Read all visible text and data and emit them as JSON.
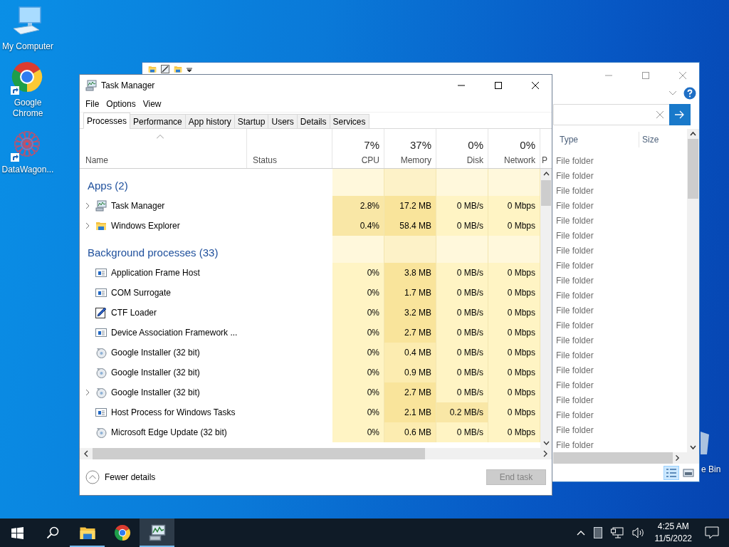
{
  "desktop": {
    "icons": [
      {
        "label": "My Computer",
        "kind": "computer",
        "shortcut": false
      },
      {
        "label": "Google Chrome",
        "kind": "chrome",
        "shortcut": true
      },
      {
        "label": "DataWagon...",
        "kind": "flake",
        "shortcut": true
      }
    ],
    "recycle_bin": {
      "label": "e Bin"
    }
  },
  "explorer": {
    "columns": [
      "Type",
      "Size"
    ],
    "rows": [
      {
        "type": "File folder"
      },
      {
        "type": "File folder"
      },
      {
        "type": "File folder"
      },
      {
        "type": "File folder"
      },
      {
        "type": "File folder"
      },
      {
        "type": "File folder"
      },
      {
        "type": "File folder"
      },
      {
        "type": "File folder"
      },
      {
        "type": "File folder"
      },
      {
        "type": "File folder"
      },
      {
        "type": "File folder"
      },
      {
        "type": "File folder"
      },
      {
        "type": "File folder"
      },
      {
        "type": "File folder"
      },
      {
        "type": "File folder"
      },
      {
        "type": "File folder"
      },
      {
        "type": "File folder"
      },
      {
        "type": "File folder"
      },
      {
        "type": "File folder"
      },
      {
        "type": "File folder"
      }
    ],
    "views": [
      {
        "kind": "details",
        "selected": true
      },
      {
        "kind": "large",
        "selected": false
      }
    ]
  },
  "task_manager": {
    "title": "Task Manager",
    "menu": [
      "File",
      "Options",
      "View"
    ],
    "tabs": [
      {
        "label": "Processes",
        "selected": true
      },
      {
        "label": "Performance",
        "selected": false
      },
      {
        "label": "App history",
        "selected": false
      },
      {
        "label": "Startup",
        "selected": false
      },
      {
        "label": "Users",
        "selected": false
      },
      {
        "label": "Details",
        "selected": false
      },
      {
        "label": "Services",
        "selected": false
      }
    ],
    "columns": [
      {
        "kind": "name",
        "label": "Name",
        "sorted": true
      },
      {
        "kind": "text",
        "label": "Status"
      },
      {
        "kind": "metric",
        "label": "CPU",
        "usage": "7%"
      },
      {
        "kind": "metric",
        "label": "Memory",
        "usage": "37%"
      },
      {
        "kind": "metric",
        "label": "Disk",
        "usage": "0%"
      },
      {
        "kind": "metric",
        "label": "Network",
        "usage": "0%"
      },
      {
        "kind": "cut",
        "label": "P"
      }
    ],
    "groups": [
      {
        "label": "Apps (2)",
        "processes": [
          {
            "name": "Task Manager",
            "kind": "monitor",
            "expandable": true,
            "cpu": "2.8%",
            "memory": "17.2 MB",
            "disk": "0 MB/s",
            "network": "0 Mbps"
          },
          {
            "name": "Windows Explorer",
            "kind": "folder",
            "expandable": true,
            "cpu": "0.4%",
            "memory": "58.4 MB",
            "disk": "0 MB/s",
            "network": "0 Mbps"
          }
        ]
      },
      {
        "label": "Background processes (33)",
        "processes": [
          {
            "name": "Application Frame Host",
            "kind": "window",
            "expandable": false,
            "cpu": "0%",
            "memory": "3.8 MB",
            "disk": "0 MB/s",
            "network": "0 Mbps"
          },
          {
            "name": "COM Surrogate",
            "kind": "window",
            "expandable": false,
            "cpu": "0%",
            "memory": "1.7 MB",
            "disk": "0 MB/s",
            "network": "0 Mbps"
          },
          {
            "name": "CTF Loader",
            "kind": "pen",
            "expandable": false,
            "cpu": "0%",
            "memory": "3.2 MB",
            "disk": "0 MB/s",
            "network": "0 Mbps"
          },
          {
            "name": "Device Association Framework ...",
            "kind": "window",
            "expandable": false,
            "cpu": "0%",
            "memory": "2.7 MB",
            "disk": "0 MB/s",
            "network": "0 Mbps"
          },
          {
            "name": "Google Installer (32 bit)",
            "kind": "disc",
            "expandable": false,
            "cpu": "0%",
            "memory": "0.4 MB",
            "disk": "0 MB/s",
            "network": "0 Mbps"
          },
          {
            "name": "Google Installer (32 bit)",
            "kind": "disc",
            "expandable": false,
            "cpu": "0%",
            "memory": "0.9 MB",
            "disk": "0 MB/s",
            "network": "0 Mbps"
          },
          {
            "name": "Google Installer (32 bit)",
            "kind": "disc",
            "expandable": true,
            "cpu": "0%",
            "memory": "2.7 MB",
            "disk": "0 MB/s",
            "network": "0 Mbps"
          },
          {
            "name": "Host Process for Windows Tasks",
            "kind": "window",
            "expandable": false,
            "cpu": "0%",
            "memory": "2.1 MB",
            "disk": "0.2 MB/s",
            "network": "0 Mbps"
          },
          {
            "name": "Microsoft Edge Update (32 bit)",
            "kind": "disc",
            "expandable": false,
            "cpu": "0%",
            "memory": "0.6 MB",
            "disk": "0 MB/s",
            "network": "0 Mbps"
          }
        ]
      }
    ],
    "details_toggle": "Fewer details",
    "end_task": {
      "label": "End task",
      "disabled": true
    }
  },
  "taskbar": {
    "items": [
      {
        "kind": "start",
        "running": false,
        "selected": false
      },
      {
        "kind": "search",
        "running": false,
        "selected": false
      },
      {
        "kind": "folder",
        "running": true,
        "selected": false
      },
      {
        "kind": "chrome",
        "running": false,
        "selected": false
      },
      {
        "kind": "monitor",
        "running": true,
        "selected": true
      }
    ],
    "time": "4:25 AM",
    "date": "11/5/2022"
  }
}
